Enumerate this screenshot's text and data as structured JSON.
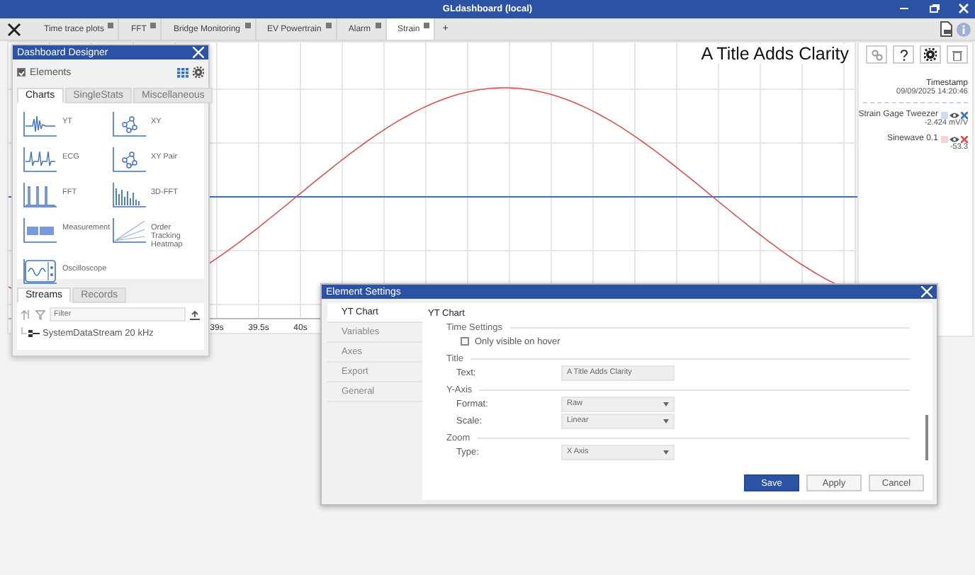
{
  "window": {
    "title": "GLdashboard (local)"
  },
  "tabs": [
    {
      "label": "Time trace plots",
      "selected": false
    },
    {
      "label": "FFT",
      "selected": false
    },
    {
      "label": "Bridge Monitoring",
      "selected": false
    },
    {
      "label": "EV Powertrain",
      "selected": false
    },
    {
      "label": "Alarm",
      "selected": false
    },
    {
      "label": "Strain",
      "selected": true
    }
  ],
  "add_tab": "+",
  "chart": {
    "title": "A Title Adds Clarity",
    "x_tick_labels": [
      "39s",
      "39.5s",
      "40s"
    ]
  },
  "legend": {
    "timestamp_label": "Timestamp",
    "timestamp": "09/09/2025 14:20:46",
    "channels": [
      {
        "name": "Strain Gage Tweezer",
        "color": "#3f6fc9",
        "value": "-2.424 mV/V"
      },
      {
        "name": "Sinewave 0.1",
        "color": "#d9534f",
        "value": "-53.3"
      }
    ]
  },
  "designer": {
    "title": "Dashboard Designer",
    "elements_label": "Elements",
    "elements_checked": true,
    "tabs": [
      {
        "label": "Charts",
        "selected": true
      },
      {
        "label": "SingleStats",
        "selected": false
      },
      {
        "label": "Miscellaneous",
        "selected": false
      }
    ],
    "items": [
      {
        "label": "YT",
        "kind": "yt"
      },
      {
        "label": "XY",
        "kind": "xy"
      },
      {
        "label": "ECG",
        "kind": "ecg"
      },
      {
        "label": "XY Pair",
        "kind": "xypair"
      },
      {
        "label": "FFT",
        "kind": "fft"
      },
      {
        "label": "3D-FFT",
        "kind": "fft3d"
      },
      {
        "label": "Measurement",
        "kind": "measurement"
      },
      {
        "label": "Order Tracking Heatmap",
        "kind": "heatmap"
      },
      {
        "label": "Oscilloscope",
        "kind": "oscilloscope"
      }
    ],
    "stream_tabs": [
      {
        "label": "Streams",
        "selected": true
      },
      {
        "label": "Records",
        "selected": false
      }
    ],
    "filter": {
      "placeholder": "Filter"
    },
    "streams": [
      {
        "label": "SystemDataStream 20 kHz"
      }
    ]
  },
  "settings": {
    "title": "Element Settings",
    "nav": [
      {
        "label": "YT Chart",
        "selected": true
      },
      {
        "label": "Variables",
        "selected": false
      },
      {
        "label": "Axes",
        "selected": false
      },
      {
        "label": "Export",
        "selected": false
      },
      {
        "label": "General",
        "selected": false
      }
    ],
    "heading": "YT Chart",
    "sections": [
      {
        "title": "Time Settings",
        "rows": [
          {
            "kind": "checkbox",
            "label": "Only visible on hover",
            "checked": false
          }
        ]
      },
      {
        "title": "Title",
        "rows": [
          {
            "kind": "text",
            "label": "Text:",
            "value": "A Title Adds Clarity"
          }
        ]
      },
      {
        "title": "Y-Axis",
        "rows": [
          {
            "kind": "select",
            "label": "Format:",
            "value": "Raw"
          },
          {
            "kind": "select",
            "label": "Scale:",
            "value": "Linear"
          }
        ]
      },
      {
        "title": "Zoom",
        "rows": [
          {
            "kind": "select",
            "label": "Type:",
            "value": "X Axis"
          }
        ]
      }
    ],
    "buttons": [
      {
        "label": "Save",
        "kind": "primary"
      },
      {
        "label": "Apply",
        "kind": "secondary"
      },
      {
        "label": "Cancel",
        "kind": "secondary"
      }
    ]
  }
}
